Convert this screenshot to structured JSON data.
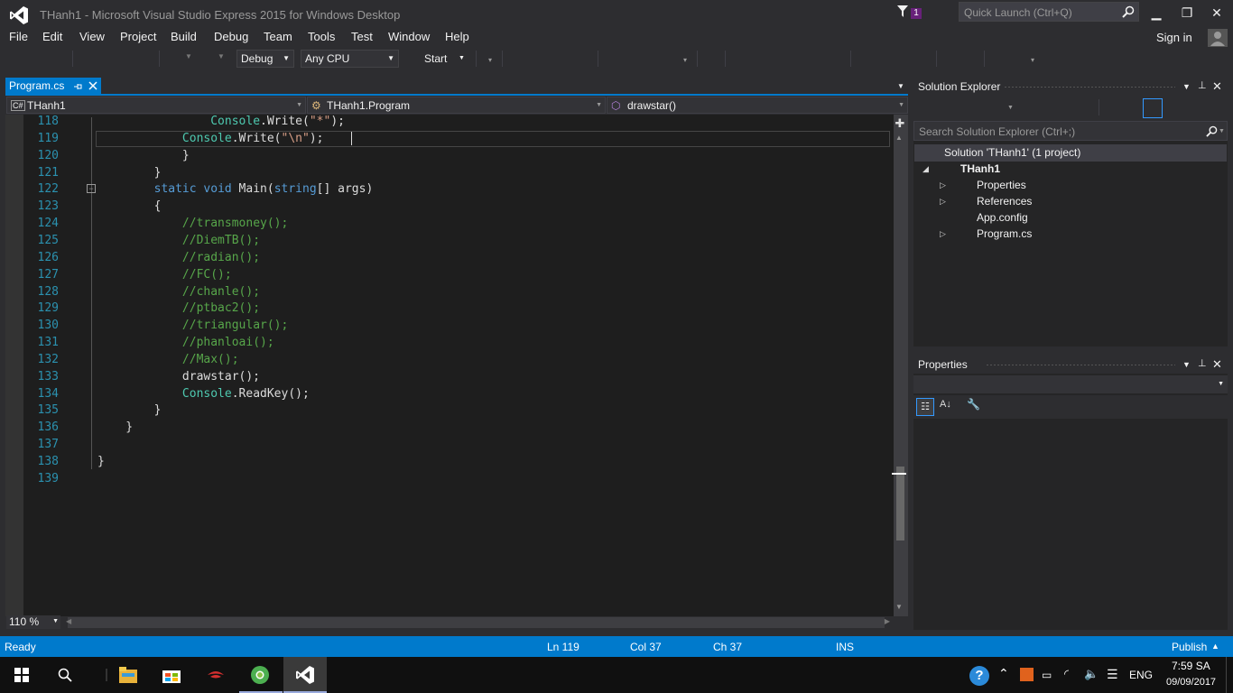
{
  "window": {
    "title": "THanh1 - Microsoft Visual Studio Express 2015 for Windows Desktop",
    "notification_count": "1",
    "quick_launch_placeholder": "Quick Launch (Ctrl+Q)",
    "minimize": "▁",
    "restore": "❐",
    "close": "✕"
  },
  "menu": {
    "file": "File",
    "edit": "Edit",
    "view": "View",
    "project": "Project",
    "build": "Build",
    "debug": "Debug",
    "team": "Team",
    "tools": "Tools",
    "test": "Test",
    "window": "Window",
    "help": "Help",
    "signin": "Sign in"
  },
  "toolbar": {
    "config": "Debug",
    "platform": "Any CPU",
    "start": "Start"
  },
  "tabs": {
    "active": "Program.cs"
  },
  "navbar": {
    "project": "THanh1",
    "type": "THanh1.Program",
    "member": "drawstar()"
  },
  "code": {
    "lines": [
      {
        "n": "118",
        "parts": [
          [
            "",
            "                "
          ],
          [
            "cls",
            "Console"
          ],
          [
            "",
            ".Write("
          ],
          [
            "str",
            "\"*\""
          ],
          [
            "",
            ");"
          ]
        ]
      },
      {
        "n": "119",
        "parts": [
          [
            "",
            "            "
          ],
          [
            "cls",
            "Console"
          ],
          [
            "",
            ".Write("
          ],
          [
            "str",
            "\"\\n\""
          ],
          [
            "",
            ");"
          ]
        ]
      },
      {
        "n": "120",
        "parts": [
          [
            "",
            "            }"
          ]
        ]
      },
      {
        "n": "121",
        "parts": [
          [
            "",
            "        }"
          ]
        ]
      },
      {
        "n": "122",
        "parts": [
          [
            "",
            "        "
          ],
          [
            "kw",
            "static"
          ],
          [
            "",
            " "
          ],
          [
            "kw",
            "void"
          ],
          [
            "",
            " Main("
          ],
          [
            "kw",
            "string"
          ],
          [
            "",
            "[] args)"
          ]
        ]
      },
      {
        "n": "123",
        "parts": [
          [
            "",
            "        {"
          ]
        ]
      },
      {
        "n": "124",
        "parts": [
          [
            "",
            "            "
          ],
          [
            "cmt",
            "//transmoney();"
          ]
        ]
      },
      {
        "n": "125",
        "parts": [
          [
            "",
            "            "
          ],
          [
            "cmt",
            "//DiemTB();"
          ]
        ]
      },
      {
        "n": "126",
        "parts": [
          [
            "",
            "            "
          ],
          [
            "cmt",
            "//radian();"
          ]
        ]
      },
      {
        "n": "127",
        "parts": [
          [
            "",
            "            "
          ],
          [
            "cmt",
            "//FC();"
          ]
        ]
      },
      {
        "n": "128",
        "parts": [
          [
            "",
            "            "
          ],
          [
            "cmt",
            "//chanle();"
          ]
        ]
      },
      {
        "n": "129",
        "parts": [
          [
            "",
            "            "
          ],
          [
            "cmt",
            "//ptbac2();"
          ]
        ]
      },
      {
        "n": "130",
        "parts": [
          [
            "",
            "            "
          ],
          [
            "cmt",
            "//triangular();"
          ]
        ]
      },
      {
        "n": "131",
        "parts": [
          [
            "",
            "            "
          ],
          [
            "cmt",
            "//phanloai();"
          ]
        ]
      },
      {
        "n": "132",
        "parts": [
          [
            "",
            "            "
          ],
          [
            "cmt",
            "//Max();"
          ]
        ]
      },
      {
        "n": "133",
        "parts": [
          [
            "",
            "            drawstar();"
          ]
        ]
      },
      {
        "n": "134",
        "parts": [
          [
            "",
            "            "
          ],
          [
            "cls",
            "Console"
          ],
          [
            "",
            ".ReadKey();"
          ]
        ]
      },
      {
        "n": "135",
        "parts": [
          [
            "",
            "        }"
          ]
        ]
      },
      {
        "n": "136",
        "parts": [
          [
            "",
            "    }"
          ]
        ]
      },
      {
        "n": "137",
        "parts": [
          [
            "",
            ""
          ]
        ]
      },
      {
        "n": "138",
        "parts": [
          [
            "",
            "}"
          ]
        ]
      },
      {
        "n": "139",
        "parts": [
          [
            "",
            ""
          ]
        ]
      }
    ]
  },
  "zoom": "110 %",
  "solution_explorer": {
    "title": "Solution Explorer",
    "search_placeholder": "Search Solution Explorer (Ctrl+;)",
    "solution": "Solution 'THanh1' (1 project)",
    "project": "THanh1",
    "items": [
      "Properties",
      "References",
      "App.config",
      "Program.cs"
    ]
  },
  "properties": {
    "title": "Properties"
  },
  "status": {
    "ready": "Ready",
    "ln": "Ln 119",
    "col": "Col 37",
    "ch": "Ch 37",
    "ins": "INS",
    "publish": "Publish"
  },
  "taskbar": {
    "lang": "ENG",
    "time": "7:59 SA",
    "date": "09/09/2017"
  },
  "colors": {
    "accent": "#007acc",
    "editor_bg": "#1e1e1e",
    "comment": "#57a64a",
    "keyword": "#569cd6",
    "type": "#4ec9b0",
    "string": "#d69d85",
    "line_number": "#2b91af"
  }
}
